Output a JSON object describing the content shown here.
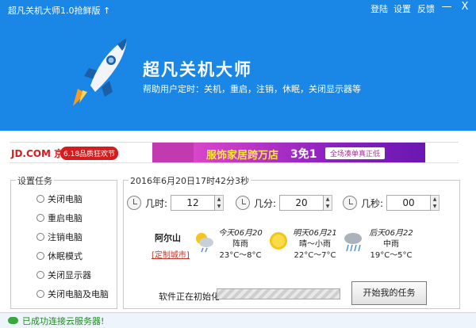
{
  "window": {
    "title": "超凡关机大师1.0抢鲜版",
    "title_arrow": "↑",
    "links": {
      "login": "登陆",
      "settings": "设置",
      "feedback": "反馈"
    },
    "controls": {
      "minimize": "—",
      "close": "X"
    }
  },
  "header": {
    "app_name": "超凡关机大师",
    "subtitle": "帮助用户定时：关机，重启，注销，休眠，关闭显示器等"
  },
  "ad": {
    "brand": "JD.COM 京东",
    "badge": "6.18品质狂欢节",
    "headline": "服饰家居跨万店",
    "promo": "3免1",
    "pill": "全场凑单真正低"
  },
  "tasks": {
    "legend": "设置任务",
    "options": [
      "关闭电脑",
      "重启电脑",
      "注销电脑",
      "休眠模式",
      "关闭显示器",
      "关闭电脑及电脑"
    ]
  },
  "timer": {
    "datetime": "2016年6月20日17时42分3秒",
    "hours": {
      "label": "几时:",
      "value": "12"
    },
    "minutes": {
      "label": "几分:",
      "value": "20"
    },
    "seconds": {
      "label": "几秒:",
      "value": "00"
    },
    "spin_up": "▲",
    "spin_down": "▼"
  },
  "weather": {
    "city": "阿尔山",
    "custom_link": "[定制城市]",
    "days": [
      {
        "title": "今天06月20",
        "cond": "阵雨",
        "temp": "23°C～8°C",
        "icon": "rain-icon"
      },
      {
        "title": "明天06月21",
        "cond": "晴～小雨",
        "temp": "22°C～7°C",
        "icon": "sun-icon"
      },
      {
        "title": "后天06月22",
        "cond": "中雨",
        "temp": "19°C～5°C",
        "icon": "heavy-rain-icon"
      }
    ]
  },
  "progress": {
    "label": "软件正在初始化",
    "value": 0
  },
  "start_button": "开始我的任务",
  "status": "已成功连接云服务器!",
  "colors": {
    "header": "#1a87e6",
    "status_text": "#1f8c1f"
  }
}
